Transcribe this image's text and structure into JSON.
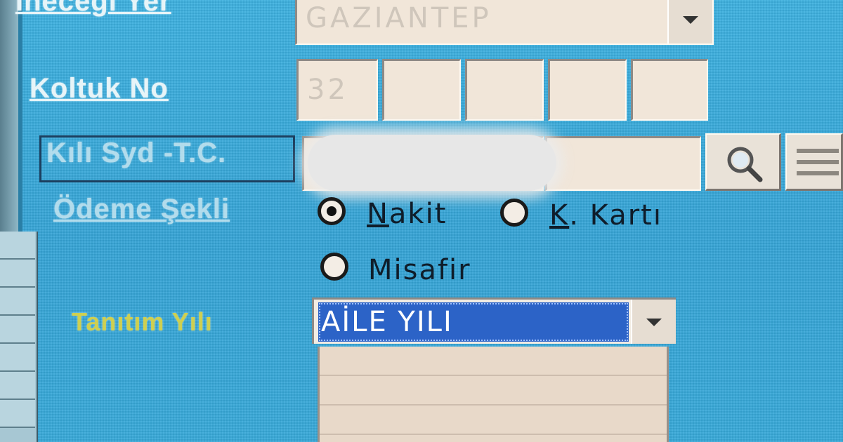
{
  "form": {
    "inecegi_yer": {
      "label": "İneceği Yer",
      "value": "GAZIANTEP"
    },
    "koltuk_no": {
      "label": "Koltuk No",
      "values": [
        "32",
        "",
        "",
        "",
        ""
      ]
    },
    "kili_syd": {
      "label": "Kılı Syd -T.C."
    },
    "odeme_sekli": {
      "label": "Ödeme Şekli",
      "options": [
        {
          "label": "Nakit",
          "mnemonic": "N",
          "rest": "akit",
          "checked": true
        },
        {
          "label": "K. Kartı",
          "mnemonic": "K",
          "rest": ". Kartı",
          "checked": false
        },
        {
          "label": "Misafir",
          "checked": false
        }
      ]
    },
    "tanitim_yili": {
      "label": "Tanıtım Yılı",
      "selected": "AİLE YILI"
    }
  },
  "icons": {
    "search": "search-icon",
    "menu": "menu-icon",
    "dropdown": "chevron-down-icon"
  },
  "colors": {
    "background": "#3aa9da",
    "selection": "#2c63c7",
    "field": "#f1e6d9",
    "highlight_label": "#e8d83a"
  }
}
